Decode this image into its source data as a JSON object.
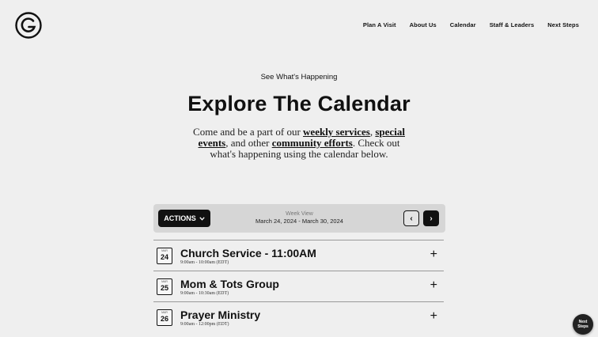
{
  "nav": {
    "items": [
      "Plan A Visit",
      "About Us",
      "Calendar",
      "Staff & Leaders",
      "Next Steps"
    ]
  },
  "hero": {
    "eyebrow": "See What's Happening",
    "title": "Explore The Calendar",
    "intro_1": "Come and be a part of our ",
    "link_1": "weekly services",
    "intro_2": ", ",
    "link_2": "special events",
    "intro_3": ", and other ",
    "link_3": "community efforts",
    "intro_4": ". Check out what's happening using the calendar below."
  },
  "toolbar": {
    "actions_label": "ACTIONS",
    "week_label": "Week View",
    "week_range": "March 24, 2024 - March 30, 2024",
    "prev_glyph": "‹",
    "next_glyph": "›"
  },
  "events": [
    {
      "month": "MAR",
      "day": "24",
      "title": "Church Service - 11:00AM",
      "time": "9:00am - 10:00am (EDT)"
    },
    {
      "month": "MAR",
      "day": "25",
      "title": "Mom & Tots Group",
      "time": "9:00am - 10:30am (EDT)"
    },
    {
      "month": "MAR",
      "day": "26",
      "title": "Prayer Ministry",
      "time": "9:00am - 12:00pm (EDT)"
    }
  ],
  "chat": {
    "label_1": "Next",
    "label_2": "Steps"
  },
  "icons": {
    "logo": "g-logo-icon",
    "chevron": "chevron-down-icon",
    "plus": "plus-icon"
  }
}
